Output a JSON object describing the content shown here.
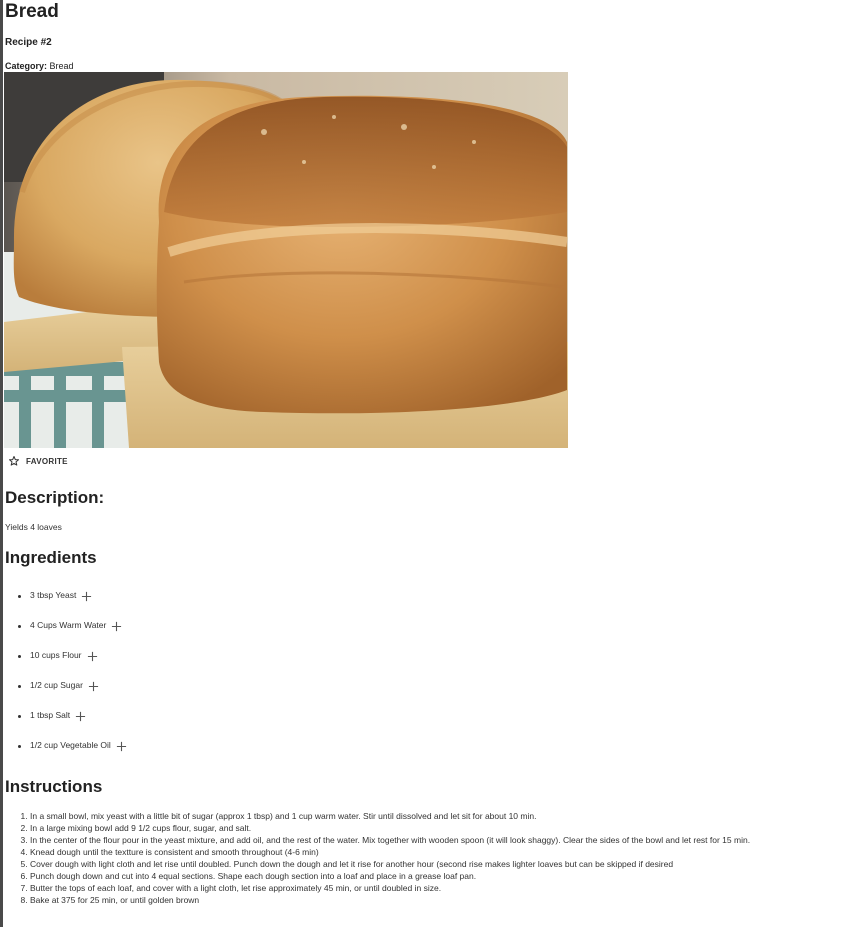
{
  "recipe": {
    "title": "Bread",
    "number_label": "Recipe #2",
    "category_label": "Category:",
    "category_value": "Bread"
  },
  "favorite": {
    "label": "FAVORITE",
    "icon": "star-outline-icon"
  },
  "description": {
    "heading": "Description:",
    "text": "Yields 4 loaves"
  },
  "ingredients": {
    "heading": "Ingredients",
    "items": [
      "3 tbsp Yeast",
      "4 Cups Warm Water",
      "10 cups Flour",
      "1/2 cup Sugar",
      "1 tbsp Salt",
      "1/2 cup Vegetable Oil"
    ],
    "add_icon": "plus-icon"
  },
  "instructions": {
    "heading": "Instructions",
    "steps": [
      "In a small bowl, mix yeast with a little bit of sugar (approx 1 tbsp) and 1 cup warm water. Stir until dissolved and let sit for about 10 min.",
      "In a large mixing bowl add 9 1/2 cups flour, sugar, and salt.",
      "In the center of the flour pour in the yeast mixture, and add oil, and the rest of the water. Mix together with wooden spoon (it will look shaggy). Clear the sides of the bowl and let rest for 15 min.",
      "Knead dough until the textture is consistent and smooth throughout (4-6 min)",
      "Cover dough with light cloth and let rise until doubled. Punch down the dough and let it rise for another hour (second rise makes lighter loaves but can be skipped if desired",
      "Punch dough down and cut into 4 equal sections. Shape each dough section into a loaf and place in a grease loaf pan.",
      "Butter the tops of each loaf, and cover with a light cloth, let rise approximately 45 min, or until doubled in size.",
      "Bake at 375 for 25 min, or until golden brown"
    ]
  }
}
